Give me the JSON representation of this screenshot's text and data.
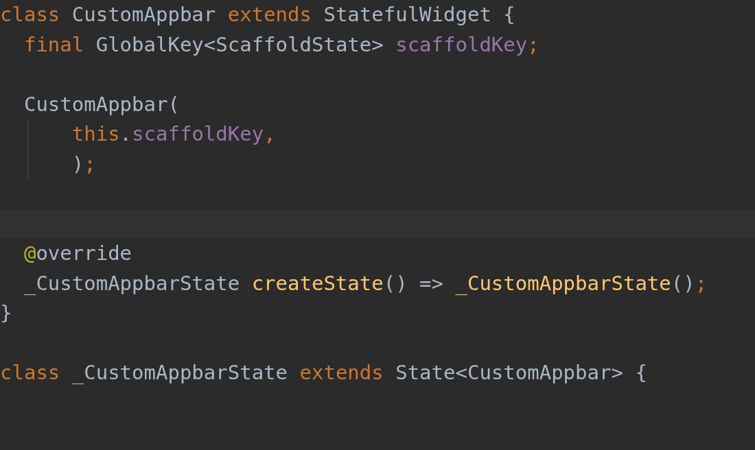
{
  "editor": {
    "lines": [
      {
        "kind": "code",
        "tokens": [
          {
            "kind": "keyword",
            "text": "class "
          },
          {
            "kind": "plain",
            "text": "CustomAppbar "
          },
          {
            "kind": "keyword",
            "text": "extends "
          },
          {
            "kind": "plain",
            "text": "StatefulWidget {"
          }
        ]
      },
      {
        "kind": "code",
        "tokens": [
          {
            "kind": "keyword",
            "text": "  final "
          },
          {
            "kind": "plain",
            "text": "GlobalKey<ScaffoldState> "
          },
          {
            "kind": "field",
            "text": "scaffoldKey"
          },
          {
            "kind": "keyword",
            "text": ";"
          }
        ]
      },
      {
        "kind": "blank"
      },
      {
        "kind": "code",
        "tokens": [
          {
            "kind": "plain",
            "text": "  CustomAppbar("
          }
        ],
        "children": [
          {
            "kind": "code",
            "tokens": [
              {
                "kind": "keyword",
                "text": "      this"
              },
              {
                "kind": "plain",
                "text": "."
              },
              {
                "kind": "field",
                "text": "scaffoldKey"
              },
              {
                "kind": "keyword",
                "text": ","
              }
            ]
          },
          {
            "kind": "code",
            "tokens": [
              {
                "kind": "plain",
                "text": "      )"
              },
              {
                "kind": "keyword",
                "text": ";"
              }
            ]
          }
        ]
      },
      {
        "kind": "blank"
      },
      {
        "kind": "highlighted"
      },
      {
        "kind": "code",
        "tokens": [
          {
            "kind": "annotation",
            "text": "  @"
          },
          {
            "kind": "plain",
            "text": "override"
          }
        ]
      },
      {
        "kind": "code",
        "tokens": [
          {
            "kind": "plain",
            "text": "  _CustomAppbarState "
          },
          {
            "kind": "method",
            "text": "createState"
          },
          {
            "kind": "plain",
            "text": "() => "
          },
          {
            "kind": "method",
            "text": "_CustomAppbarState"
          },
          {
            "kind": "plain",
            "text": "()"
          },
          {
            "kind": "keyword",
            "text": ";"
          }
        ]
      },
      {
        "kind": "code",
        "tokens": [
          {
            "kind": "plain",
            "text": "}"
          }
        ]
      },
      {
        "kind": "blank"
      },
      {
        "kind": "code",
        "tokens": [
          {
            "kind": "keyword",
            "text": "class "
          },
          {
            "kind": "plain",
            "text": "_CustomAppbarState "
          },
          {
            "kind": "keyword",
            "text": "extends "
          },
          {
            "kind": "plain",
            "text": "State<CustomAppbar> {"
          }
        ]
      }
    ]
  }
}
